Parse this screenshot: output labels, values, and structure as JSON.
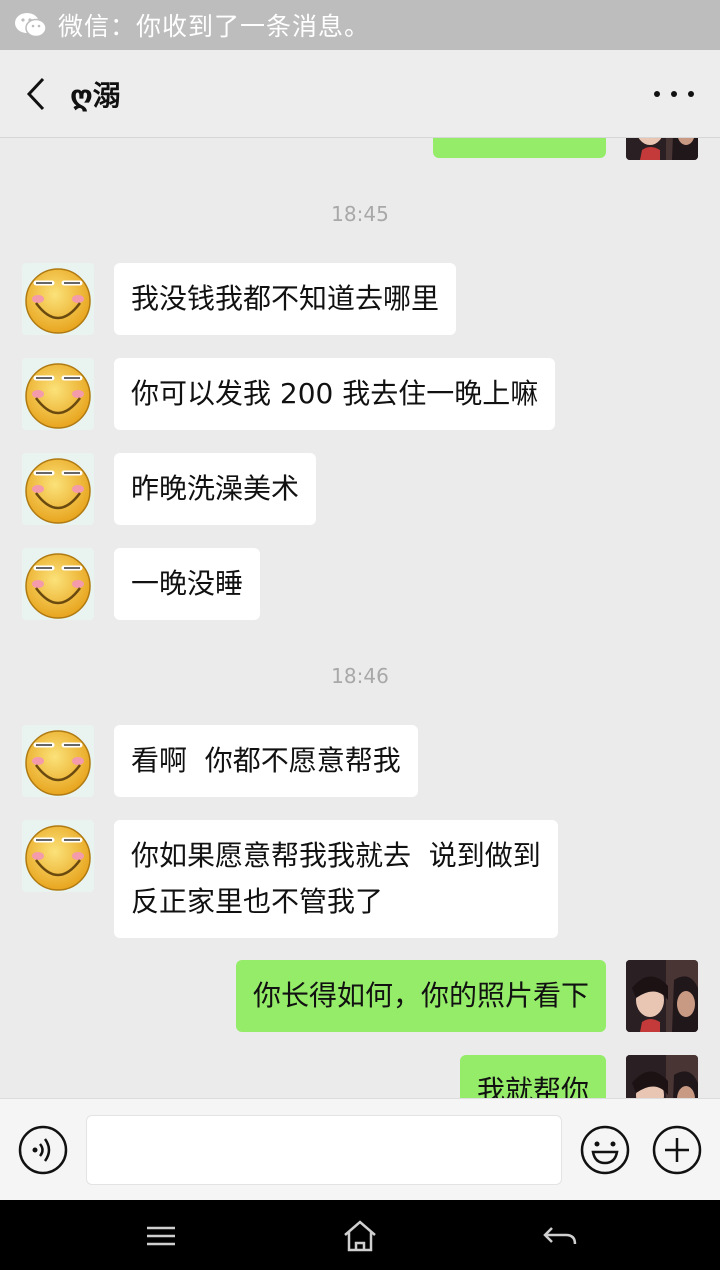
{
  "notification": {
    "text": "微信：你收到了一条消息。"
  },
  "header": {
    "title": "ღ溺"
  },
  "timestamps": [
    "18:45",
    "18:46"
  ],
  "messages": [
    {
      "side": "in",
      "text": "我没钱我都不知道去哪里"
    },
    {
      "side": "in",
      "text": "你可以发我 200 我去住一晚上嘛"
    },
    {
      "side": "in",
      "text": "昨晚洗澡美术"
    },
    {
      "side": "in",
      "text": "一晚没睡"
    },
    {
      "side": "in",
      "text": "看啊  你都不愿意帮我"
    },
    {
      "side": "in",
      "line1": "你如果愿意帮我我就去  说到做到",
      "line2": "反正家里也不管我了"
    },
    {
      "side": "out",
      "text": "你长得如何，你的照片看下"
    },
    {
      "side": "out",
      "text": "我就帮你"
    }
  ],
  "input": {
    "placeholder": ""
  },
  "icons": {
    "notification": "wechat-icon",
    "back": "back-arrow-icon",
    "more": "more-icon",
    "voice": "voice-icon",
    "emoji": "emoji-icon",
    "plus": "plus-icon",
    "menu": "menu-icon",
    "home": "home-icon",
    "return": "return-icon"
  },
  "colors": {
    "outgoing_bubble": "#95ec69",
    "incoming_bubble": "#ffffff",
    "background": "#ebebeb"
  }
}
